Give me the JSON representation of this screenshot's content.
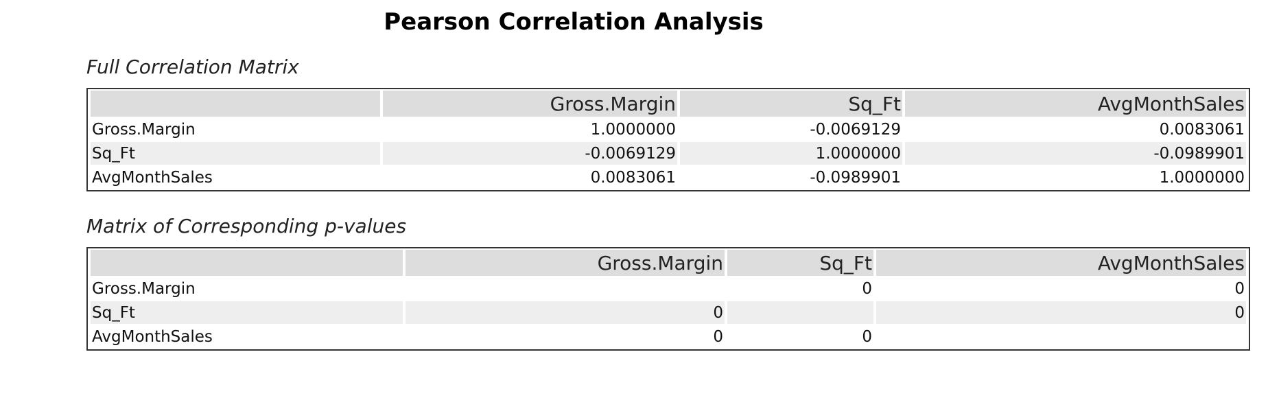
{
  "title": "Pearson Correlation Analysis",
  "correlation_matrix": {
    "heading": "Full Correlation Matrix",
    "columns": [
      "",
      "Gross.Margin",
      "Sq_Ft",
      "AvgMonthSales"
    ],
    "rows": [
      {
        "label": "Gross.Margin",
        "values": [
          "1.0000000",
          "-0.0069129",
          "0.0083061"
        ]
      },
      {
        "label": "Sq_Ft",
        "values": [
          "-0.0069129",
          "1.0000000",
          "-0.0989901"
        ]
      },
      {
        "label": "AvgMonthSales",
        "values": [
          "0.0083061",
          "-0.0989901",
          "1.0000000"
        ]
      }
    ]
  },
  "pvalue_matrix": {
    "heading": "Matrix of Corresponding p-values",
    "columns": [
      "",
      "Gross.Margin",
      "Sq_Ft",
      "AvgMonthSales"
    ],
    "rows": [
      {
        "label": "Gross.Margin",
        "values": [
          "",
          "0",
          "0"
        ]
      },
      {
        "label": "Sq_Ft",
        "values": [
          "0",
          "",
          "0"
        ]
      },
      {
        "label": "AvgMonthSales",
        "values": [
          "0",
          "0",
          ""
        ]
      }
    ]
  }
}
